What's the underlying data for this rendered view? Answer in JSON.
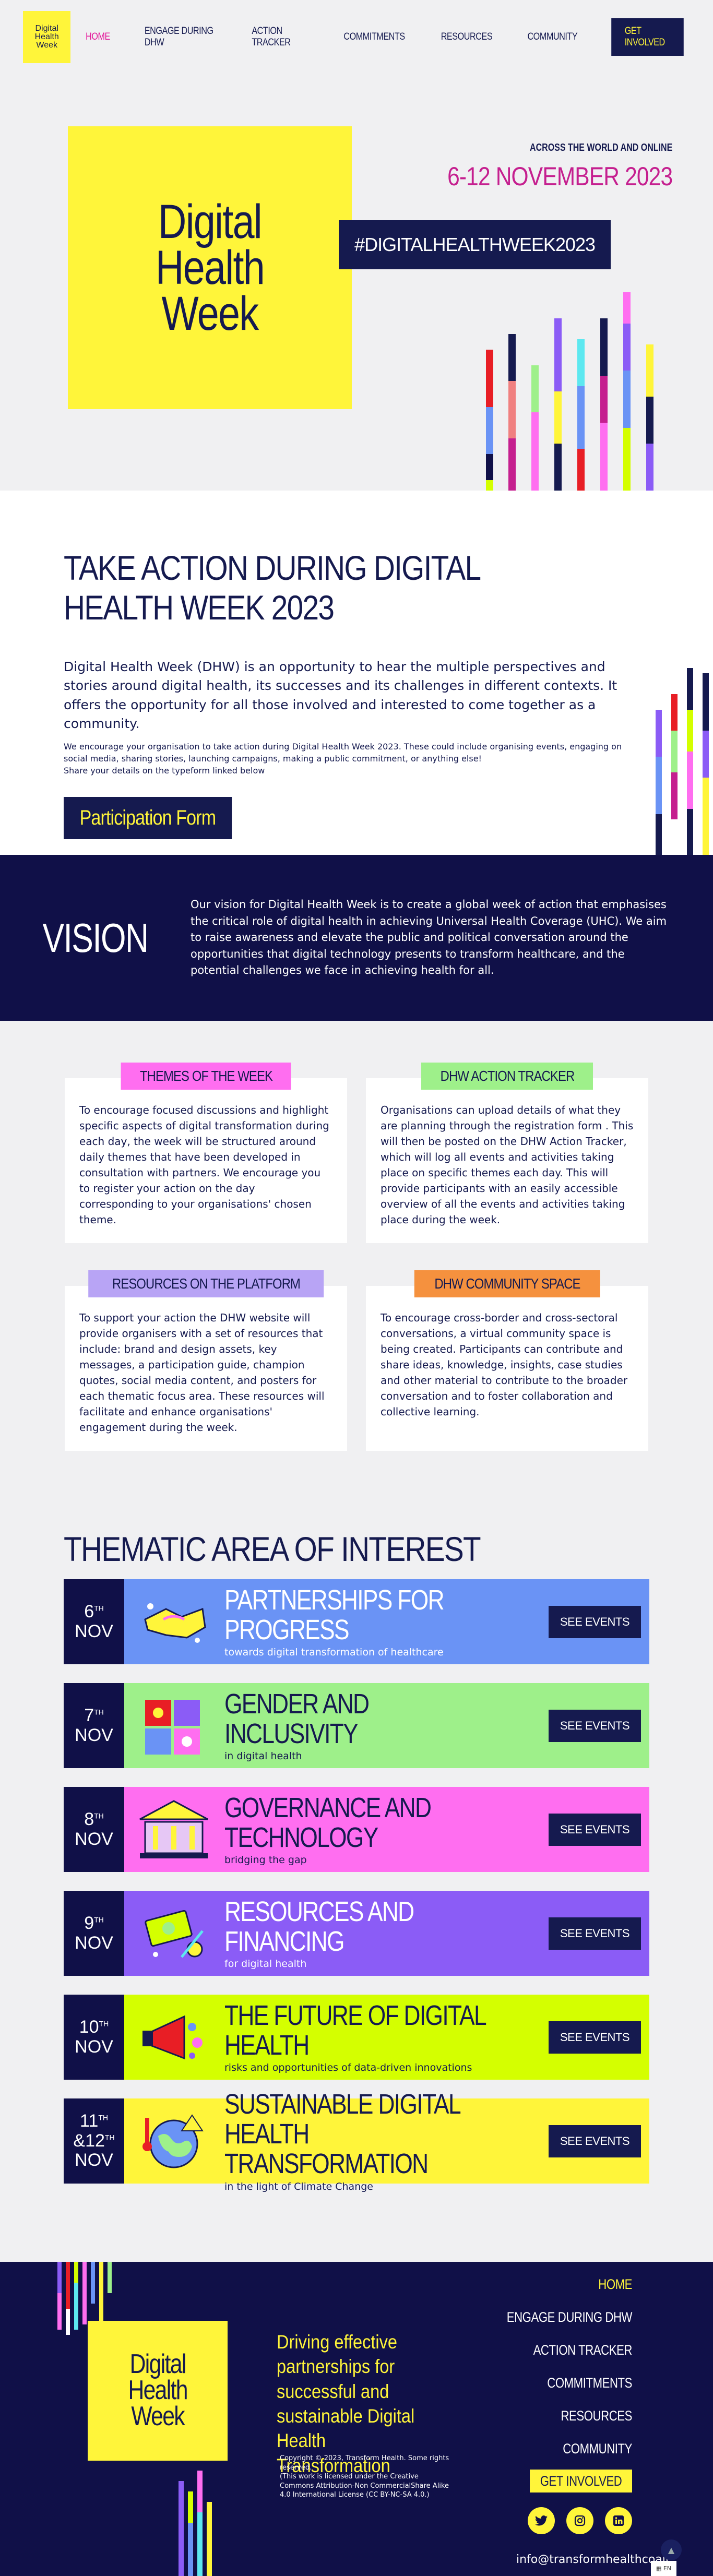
{
  "brand": {
    "logo_lines": [
      "Digital",
      "Health",
      "Week"
    ],
    "colors": {
      "navy": "#151a4f",
      "yellow": "#fff53a",
      "magenta": "#c51f8f",
      "blue": "#6a93f5",
      "green": "#9ef08a",
      "pink": "#ff6ef0",
      "purple": "#8b5cf6",
      "lime": "#d4ff00",
      "yellow_theme": "#fff53a"
    }
  },
  "nav": {
    "items": [
      {
        "label": "HOME",
        "active": true
      },
      {
        "label": "ENGAGE DURING DHW",
        "active": false
      },
      {
        "label": "ACTION TRACKER",
        "active": false
      },
      {
        "label": "COMMITMENTS",
        "active": false
      },
      {
        "label": "RESOURCES",
        "active": false
      },
      {
        "label": "COMMUNITY",
        "active": false
      }
    ],
    "cta": "GET INVOLVED"
  },
  "hero": {
    "subtitle": "ACROSS THE WORLD AND ONLINE",
    "date": "6-12 NOVEMBER 2023",
    "hashtag": "#DIGITALHEALTHWEEK2023"
  },
  "action": {
    "title": "TAKE ACTION DURING DIGITAL HEALTH WEEK 2023",
    "lead": "Digital Health Week (DHW) is an opportunity to hear the multiple perspectives and stories around digital health, its successes and its challenges in different contexts. It offers the opportunity for all those involved and interested to come together as a community.",
    "small1": "We encourage your organisation to take action during Digital Health Week 2023. These could include organising events, engaging on social media, sharing stories, launching campaigns, making a public commitment, or anything else!",
    "small2": "Share your details on the typeform linked below",
    "button": "Participation Form"
  },
  "vision": {
    "title": "VISION",
    "text": "Our vision for Digital Health Week is to create a global week of action that emphasises the critical role of digital health in achieving Universal Health Coverage (UHC). We aim to raise awareness and elevate the public and political conversation around the opportunities that digital technology presents to transform healthcare, and the potential challenges we face in achieving health for all."
  },
  "features": [
    {
      "label": "THEMES OF THE WEEK",
      "color": "#ff6ef0",
      "text": "To encourage focused discussions and highlight specific aspects of digital transformation during each day, the week will be structured around daily themes that have been developed in consultation with partners. We encourage you to register your action on the day corresponding to your organisations' chosen theme."
    },
    {
      "label": "DHW ACTION TRACKER",
      "color": "#9ef08a",
      "text": "Organisations can upload details of what they are planning through the registration form . This will then be posted on the DHW Action Tracker, which will log all events and activities taking place on specific themes each day. This will provide participants with an easily accessible overview of all the events and activities taking place during the week."
    },
    {
      "label": "RESOURCES ON THE PLATFORM",
      "color": "#b8a4f5",
      "text": "To support your action the DHW website will provide organisers with a set of resources that include: brand and design assets, key messages, a participation guide, champion quotes, social media content, and posters for each thematic focus area. These resources will facilitate and enhance organisations' engagement during the week."
    },
    {
      "label": "DHW COMMUNITY SPACE",
      "color": "#f5913e",
      "text": "To encourage cross-border and cross-sectoral conversations, a virtual community space is being created. Participants can contribute and share ideas, knowledge, insights, case studies and other material to contribute to the broader conversation and to foster collaboration and collective learning."
    }
  ],
  "thematic": {
    "title": "THEMATIC AREA OF INTEREST",
    "button": "SEE EVENTS",
    "rows": [
      {
        "day": "6",
        "sup": "TH",
        "month": "NOV",
        "title": "PARTNERSHIPS FOR PROGRESS",
        "subtitle": "towards digital transformation of healthcare",
        "bg": "#6a93f5",
        "fg": "#ffffff",
        "icon": "handshake-icon"
      },
      {
        "day": "7",
        "sup": "TH",
        "month": "NOV",
        "title": "GENDER AND INCLUSIVITY",
        "subtitle": "in digital health",
        "bg": "#9ef08a",
        "fg": "#151a4f",
        "icon": "puzzle-icon"
      },
      {
        "day": "8",
        "sup": "TH",
        "month": "NOV",
        "title": "GOVERNANCE AND TECHNOLOGY",
        "subtitle": "bridging the gap",
        "bg": "#ff6ef0",
        "fg": "#151a4f",
        "icon": "building-icon"
      },
      {
        "day": "9",
        "sup": "TH",
        "month": "NOV",
        "title": "RESOURCES AND FINANCING",
        "subtitle": "for digital health",
        "bg": "#8b5cf6",
        "fg": "#ffffff",
        "icon": "money-icon"
      },
      {
        "day": "10",
        "sup": "TH",
        "month": "NOV",
        "title": "THE FUTURE OF DIGITAL HEALTH",
        "subtitle": "risks and opportunities of data-driven innovations",
        "bg": "#d4ff00",
        "fg": "#151a4f",
        "icon": "megaphone-icon"
      },
      {
        "day": "11",
        "sup": "TH",
        "day2": "&12",
        "sup2": "TH",
        "month": "NOV",
        "title": "SUSTAINABLE DIGITAL HEALTH TRANSFORMATION",
        "subtitle": "in the light of Climate Change",
        "bg": "#fff53a",
        "fg": "#151a4f",
        "icon": "globe-icon"
      }
    ]
  },
  "footer": {
    "tagline": "Driving effective partnerships for successful and sustainable Digital Health Transformation",
    "copyright": "Copyright © 2023, Transform Health. Some rights reserved.",
    "license": "(This work is licensed under the Creative Commons Attribution-Non CommercialShare Alike 4.0 International License (CC BY-NC-SA 4.0.)",
    "nav": [
      "HOME",
      "ENGAGE DURING DHW",
      "ACTION TRACKER",
      "COMMITMENTS",
      "RESOURCES",
      "COMMUNITY"
    ],
    "cta": "GET INVOLVED",
    "email": "info@transformhealthcoali",
    "lang": "EN"
  }
}
